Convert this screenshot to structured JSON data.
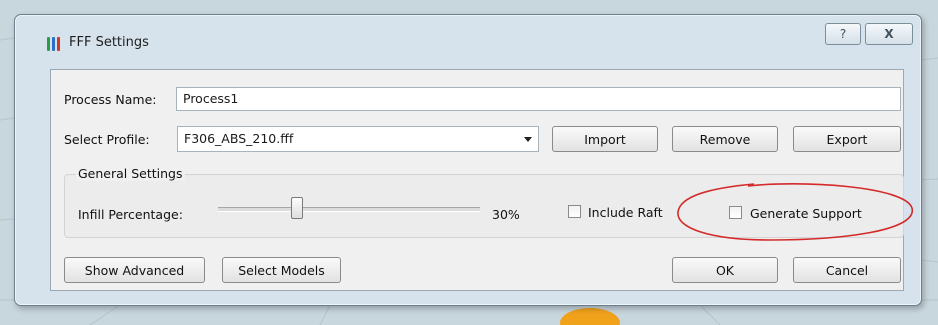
{
  "window": {
    "title": "FFF Settings",
    "help_glyph": "?",
    "close_glyph": "X"
  },
  "process": {
    "label": "Process Name:",
    "value": "Process1"
  },
  "profile": {
    "label": "Select Profile:",
    "selected": "F306_ABS_210.fff",
    "import_label": "Import",
    "remove_label": "Remove",
    "export_label": "Export"
  },
  "general": {
    "group_title": "General Settings",
    "infill_label": "Infill Percentage:",
    "infill_value": "30%",
    "infill_fraction": 0.3,
    "include_raft_label": "Include Raft",
    "include_raft_checked": false,
    "generate_support_label": "Generate Support",
    "generate_support_checked": false
  },
  "footer": {
    "show_advanced_label": "Show Advanced",
    "select_models_label": "Select Models",
    "ok_label": "OK",
    "cancel_label": "Cancel"
  },
  "colors": {
    "annotation": "#d42a2a",
    "icon_stripes": [
      "#2a9d4a",
      "#2a6fc9",
      "#c93a2a"
    ]
  }
}
